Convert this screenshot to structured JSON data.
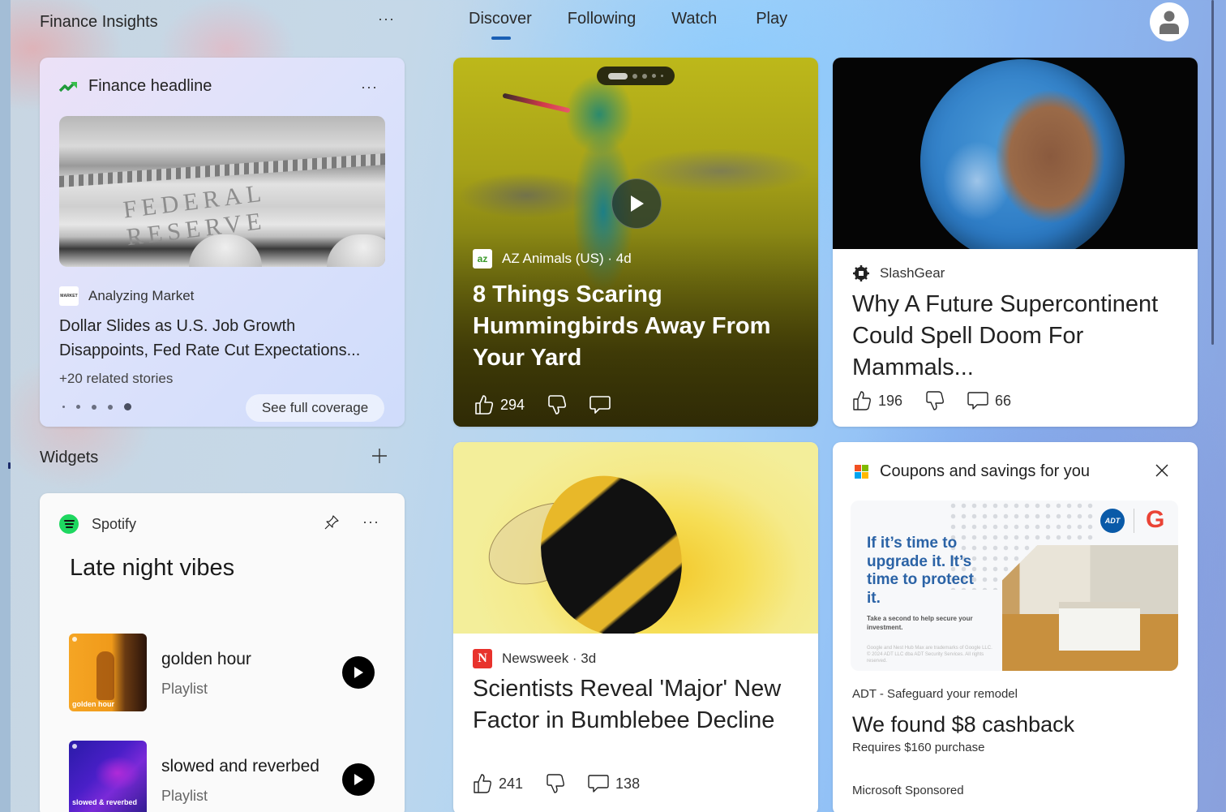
{
  "header": {
    "section_title": "Finance Insights",
    "tabs": [
      {
        "label": "Discover",
        "active": true
      },
      {
        "label": "Following",
        "active": false
      },
      {
        "label": "Watch",
        "active": false
      },
      {
        "label": "Play",
        "active": false
      }
    ],
    "avatar_icon": "person-icon"
  },
  "finance": {
    "title": "Finance headline",
    "image_caption": "FEDERAL RESERVE",
    "source": "Analyzing Market",
    "source_logo_text": "MARKET",
    "headline": "Dollar Slides as U.S. Job Growth Disappoints, Fed Rate Cut Expectations...",
    "related": "+20 related stories",
    "cta": "See full coverage",
    "pager": {
      "count": 5,
      "active_index": 4
    }
  },
  "widgets": {
    "title": "Widgets",
    "add_icon": "plus-icon"
  },
  "spotify": {
    "app": "Spotify",
    "playlist_title": "Late night vibes",
    "items": [
      {
        "name": "golden hour",
        "type": "Playlist",
        "art_label": "golden hour"
      },
      {
        "name": "slowed and reverbed",
        "type": "Playlist",
        "art_label": "slowed & reverbed"
      }
    ]
  },
  "feed": [
    {
      "source": "AZ Animals (US) · 4d",
      "source_logo": "az",
      "title": "8 Things Scaring Hummingbirds Away From Your Yard",
      "likes": "294",
      "comments": "",
      "is_video": true,
      "carousel": {
        "count": 5,
        "active_index": 0
      }
    },
    {
      "source": "SlashGear",
      "title": "Why A Future Supercontinent Could Spell Doom For Mammals...",
      "likes": "196",
      "comments": "66"
    },
    {
      "source": "Newsweek · 3d",
      "source_logo": "N",
      "title": "Scientists Reveal 'Major' New Factor in Bumblebee Decline",
      "likes": "241",
      "comments": "138"
    }
  ],
  "coupons": {
    "title": "Coupons and savings for you",
    "ad_copy": "If it’s time to upgrade it. It’s time to protect it.",
    "ad_sub": "Take a second to help secure your investment.",
    "ad_legal": "Google and Nest Hub Max are trademarks of Google LLC. © 2024 ADT LLC dba ADT Security Services. All rights reserved.",
    "adt_logo": "ADT",
    "google_logo": "G",
    "advertiser": "ADT - Safeguard your remodel",
    "headline": "We found $8 cashback",
    "requirement": "Requires $160 purchase",
    "sponsor": "Microsoft Sponsored"
  },
  "colors": {
    "accent": "#1a5fb4",
    "spotify_green": "#1ed760",
    "newsweek_red": "#e8322c",
    "finance_up": "#1f9a3a"
  }
}
